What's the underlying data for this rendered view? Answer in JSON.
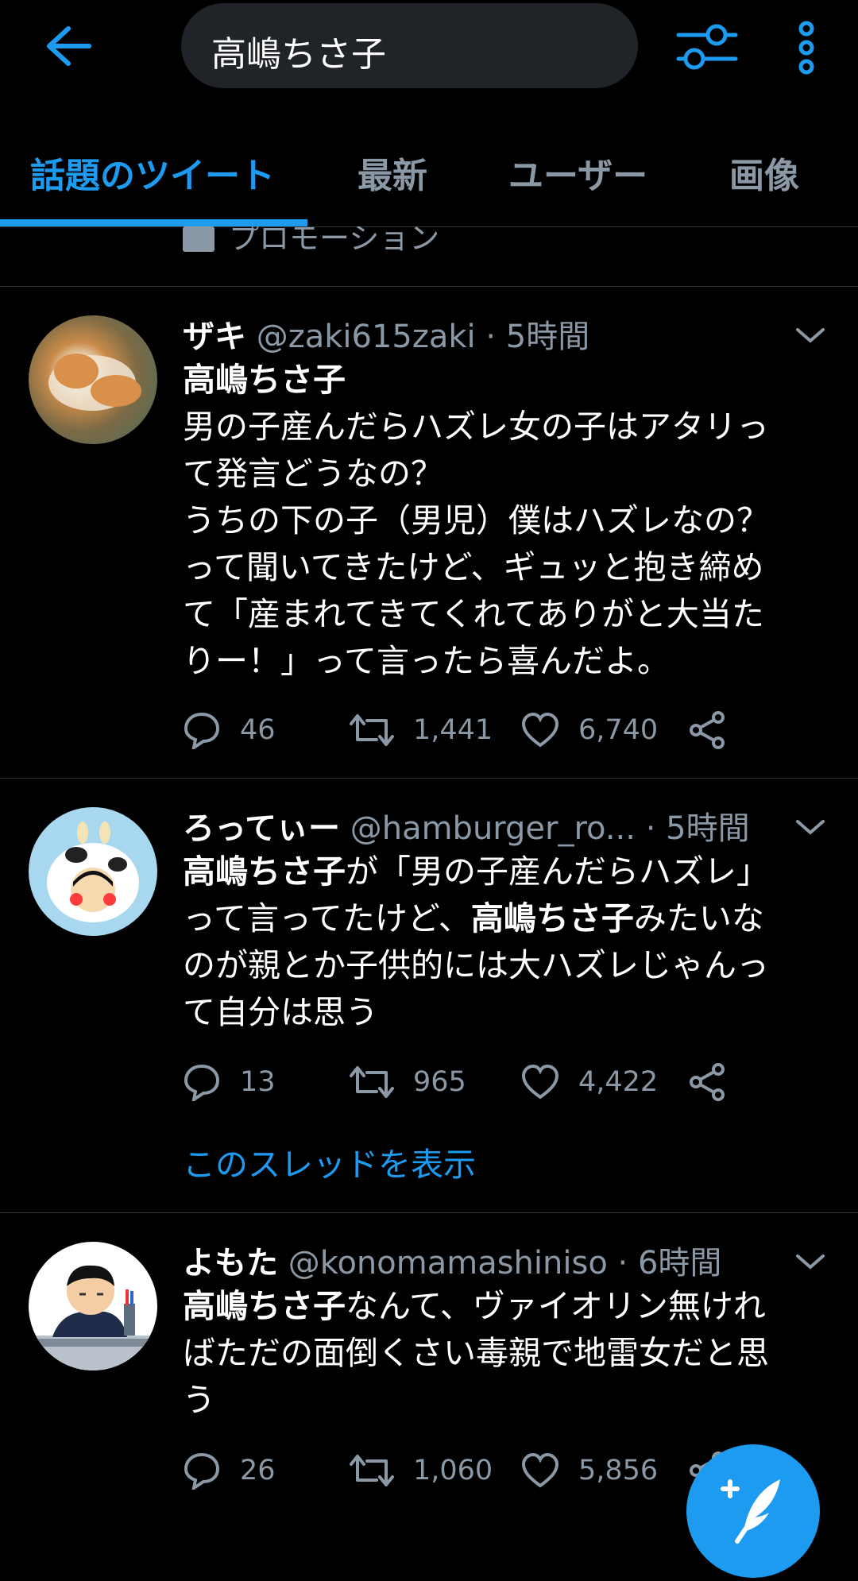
{
  "search": {
    "query": "高嶋ちさ子"
  },
  "tabs": [
    {
      "label": "話題のツイート",
      "active": true
    },
    {
      "label": "最新",
      "active": false
    },
    {
      "label": "ユーザー",
      "active": false
    },
    {
      "label": "画像",
      "active": false
    }
  ],
  "promo": {
    "label": "プロモーション"
  },
  "tweets": [
    {
      "name": "ザキ",
      "handle": "@zaki615zaki",
      "time": "· 5時間",
      "lines": [
        {
          "bold": true,
          "text": "高嶋ちさ子"
        },
        {
          "text": "男の子産んだらハズレ女の子はアタリっ"
        },
        {
          "text": "て発言どうなの？"
        },
        {
          "text": "うちの下の子（男児）僕はハズレなの？"
        },
        {
          "text": "って聞いてきたけど、ギュッと抱き締め"
        },
        {
          "text": "て「産まれてきてくれてありがと大当た"
        },
        {
          "text": "りー！」って言ったら喜んだよ。"
        }
      ],
      "replies": "46",
      "retweets": "1,441",
      "likes": "6,740"
    },
    {
      "name": "ろってぃー",
      "handle": "@hamburger_ro...",
      "time": "· 5時間",
      "line1_bold": "高嶋ちさ子",
      "line1_rest": "が「男の子産んだらハズレ」",
      "line2_pre": "って言ってたけど、",
      "line2_bold": "高嶋ちさ子",
      "line2_post": "みたいな",
      "line3": "のが親とか子供的には大ハズレじゃんっ",
      "line4": "て自分は思う",
      "replies": "13",
      "retweets": "965",
      "likes": "4,422",
      "thread_link": "このスレッドを表示"
    },
    {
      "name": "よもた",
      "handle": "@konomamashiniso",
      "time": "· 6時間",
      "line1_bold": "高嶋ちさ子",
      "line1_rest": "なんて、ヴァイオリン無けれ",
      "line2": "ばただの面倒くさい毒親で地雷女だと思",
      "line3": "う",
      "replies": "26",
      "retweets": "1,060",
      "likes": "5,856"
    }
  ],
  "colors": {
    "accent": "#1d9bf0",
    "muted": "#8b98a5",
    "divider": "#2f3336",
    "background": "#000000"
  }
}
